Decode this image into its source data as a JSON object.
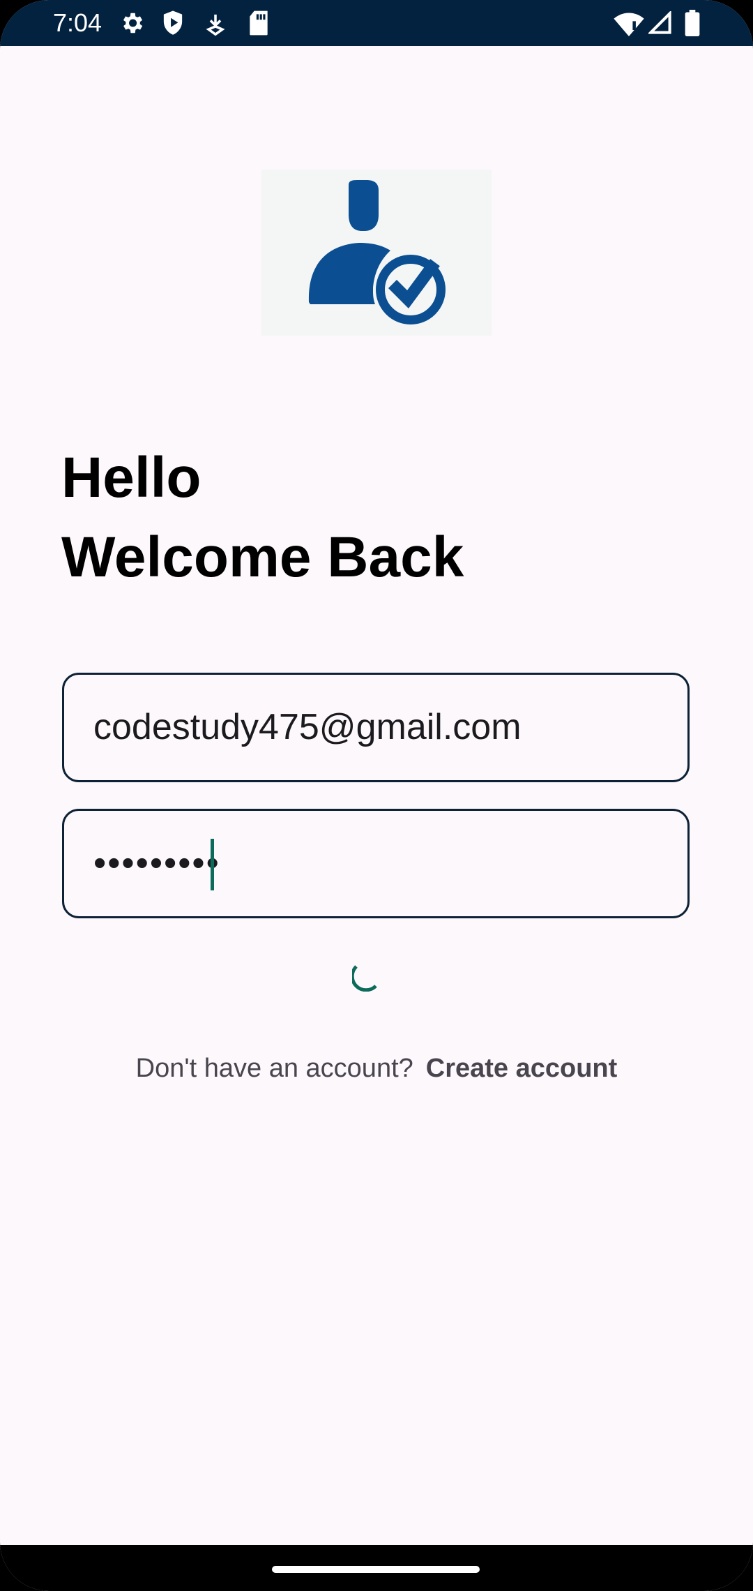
{
  "status_bar": {
    "time": "7:04",
    "left_icons": [
      "gear-icon",
      "shield-play-icon",
      "download-icon",
      "sd-card-icon"
    ],
    "right_icons": [
      "wifi-icon",
      "signal-icon",
      "battery-icon"
    ]
  },
  "logo": {
    "icon": "user-verified-icon",
    "colors": {
      "primary": "#0b4f92",
      "background": "#f4f6f5"
    }
  },
  "heading": {
    "line1": "Hello",
    "line2": "Welcome Back"
  },
  "form": {
    "email_value": "codestudy475@gmail.com",
    "password_value": "•••••••••",
    "loading": true
  },
  "footer": {
    "prompt": "Don't have an account?",
    "link": "Create account"
  },
  "colors": {
    "status_bar": "#03223f",
    "background": "#fdf8fb",
    "field_border": "#0d2236",
    "accent": "#0c6b5a"
  }
}
